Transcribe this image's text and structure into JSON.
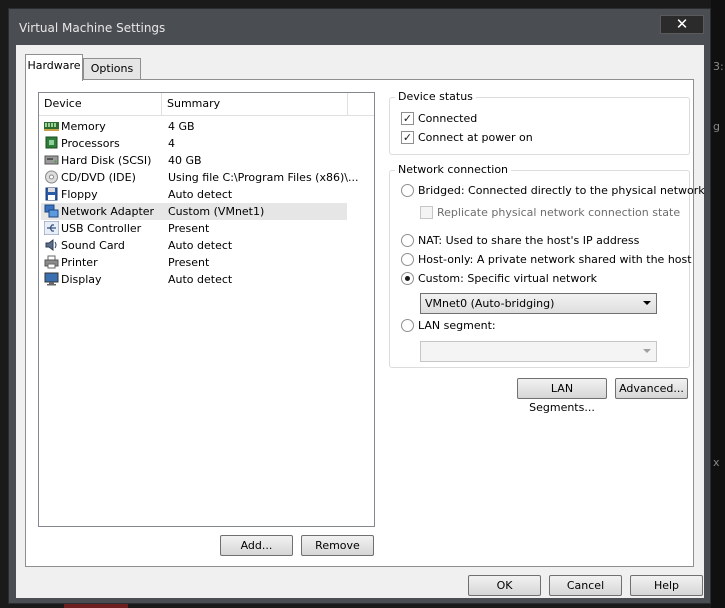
{
  "window": {
    "title": "Virtual Machine Settings",
    "close_label": "✕"
  },
  "tabs": [
    {
      "label": "Hardware"
    },
    {
      "label": "Options"
    }
  ],
  "device_list": {
    "columns": {
      "device": "Device",
      "summary": "Summary"
    },
    "rows": [
      {
        "device": "Memory",
        "summary": "4 GB",
        "icon": "memory-icon"
      },
      {
        "device": "Processors",
        "summary": "4",
        "icon": "processor-icon"
      },
      {
        "device": "Hard Disk (SCSI)",
        "summary": "40 GB",
        "icon": "hard-disk-icon"
      },
      {
        "device": "CD/DVD (IDE)",
        "summary": "Using file C:\\Program Files (x86)\\...",
        "icon": "cd-dvd-icon"
      },
      {
        "device": "Floppy",
        "summary": "Auto detect",
        "icon": "floppy-icon"
      },
      {
        "device": "Network Adapter",
        "summary": "Custom (VMnet1)",
        "icon": "network-adapter-icon",
        "selected": true
      },
      {
        "device": "USB Controller",
        "summary": "Present",
        "icon": "usb-icon"
      },
      {
        "device": "Sound Card",
        "summary": "Auto detect",
        "icon": "sound-card-icon"
      },
      {
        "device": "Printer",
        "summary": "Present",
        "icon": "printer-icon"
      },
      {
        "device": "Display",
        "summary": "Auto detect",
        "icon": "display-icon"
      }
    ],
    "add_label": "Add...",
    "remove_label": "Remove"
  },
  "device_status": {
    "title": "Device status",
    "connected": {
      "label": "Connected",
      "checked": true
    },
    "connect_at_power_on": {
      "label": "Connect at power on",
      "checked": true
    }
  },
  "network_connection": {
    "title": "Network connection",
    "bridged": {
      "label": "Bridged: Connected directly to the physical network",
      "selected": false
    },
    "replicate": {
      "label": "Replicate physical network connection state",
      "checked": false,
      "disabled": true
    },
    "nat": {
      "label": "NAT: Used to share the host's IP address",
      "selected": false
    },
    "host_only": {
      "label": "Host-only: A private network shared with the host",
      "selected": false
    },
    "custom": {
      "label": "Custom: Specific virtual network",
      "selected": true
    },
    "custom_network_value": "VMnet0 (Auto-bridging)",
    "lan_segment": {
      "label": "LAN segment:",
      "selected": false
    },
    "lan_segment_value": ""
  },
  "adapter_buttons": {
    "lan_segments_label": "LAN Segments...",
    "advanced_label": "Advanced..."
  },
  "dialog_buttons": {
    "ok_label": "OK",
    "cancel_label": "Cancel",
    "help_label": "Help"
  },
  "background": {
    "edge_texts": [
      "3:",
      "g",
      "x"
    ]
  }
}
